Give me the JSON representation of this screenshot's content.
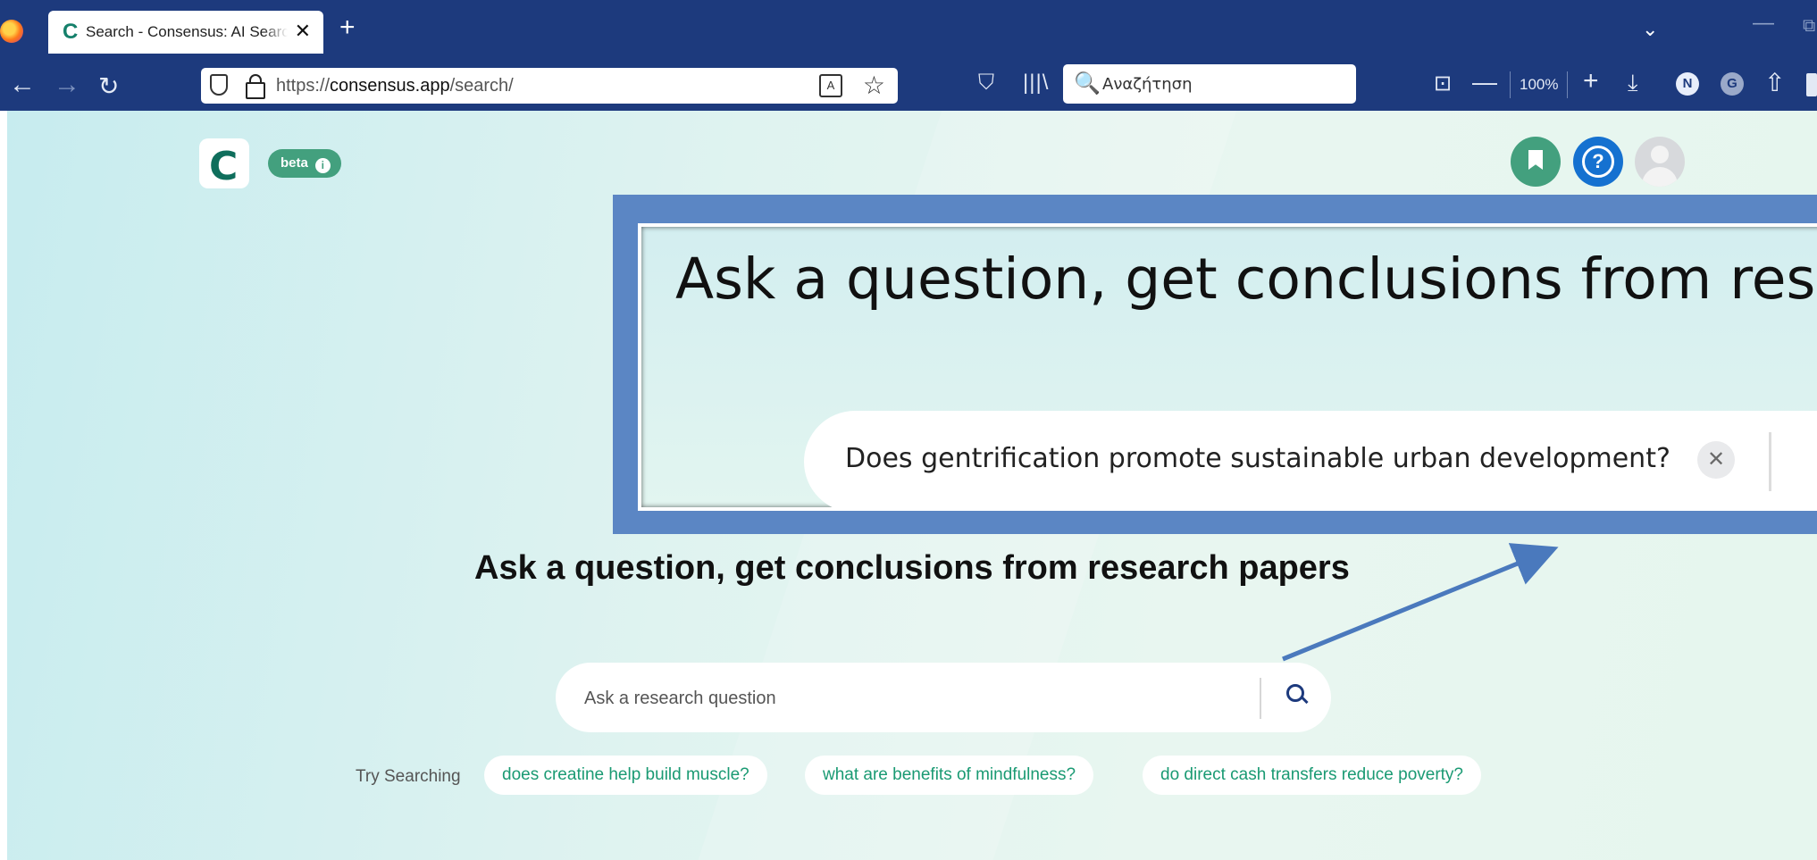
{
  "browser": {
    "tab": {
      "favicon": "C",
      "title": "Search - Consensus: AI Search Engine",
      "close": "✕"
    },
    "new_tab": "+",
    "tab_list": "⌄",
    "window_minimize": "—",
    "window_restore": "⧉",
    "nav": {
      "back": "←",
      "forward": "→",
      "reload": "↻"
    },
    "url": {
      "scheme": "https://",
      "host": "consensus.app",
      "path": "/search/"
    },
    "translate_icon_text": "A",
    "star_icon": "☆",
    "pocket_shield_icon": "⛉",
    "library_icon": "|||\\",
    "search_bar": {
      "placeholder": "Αναζήτηση",
      "icon": "🔍"
    },
    "pocket_icon": "⊡",
    "zoom": {
      "minus": "—",
      "level": "100%",
      "plus": "+"
    },
    "download_icon": "⤓",
    "extension_n": "N",
    "extension_g": "G",
    "share_icon": "⇧"
  },
  "app": {
    "logo": "C",
    "beta_badge": "beta",
    "beta_info": "i",
    "help_icon": "?",
    "zoomed_callout": {
      "heading": "Ask a question, get conclusions from research papers",
      "search_query": "Does gentrification promote sustainable urban development?",
      "clear_icon": "✕"
    },
    "heading": "Ask a question, get conclusions from research papers",
    "search": {
      "placeholder": "Ask a research question"
    },
    "try_searching": {
      "label": "Try Searching",
      "chips": [
        "does creatine help build muscle?",
        "what are benefits of mindfulness?",
        "do direct cash transfers reduce poverty?"
      ]
    }
  },
  "colors": {
    "browser_chrome": "#1d3a7d",
    "brand_green": "#43a07e",
    "help_blue": "#1571d0",
    "callout_frame": "#5b86c4",
    "chip_text": "#1a9a73"
  }
}
